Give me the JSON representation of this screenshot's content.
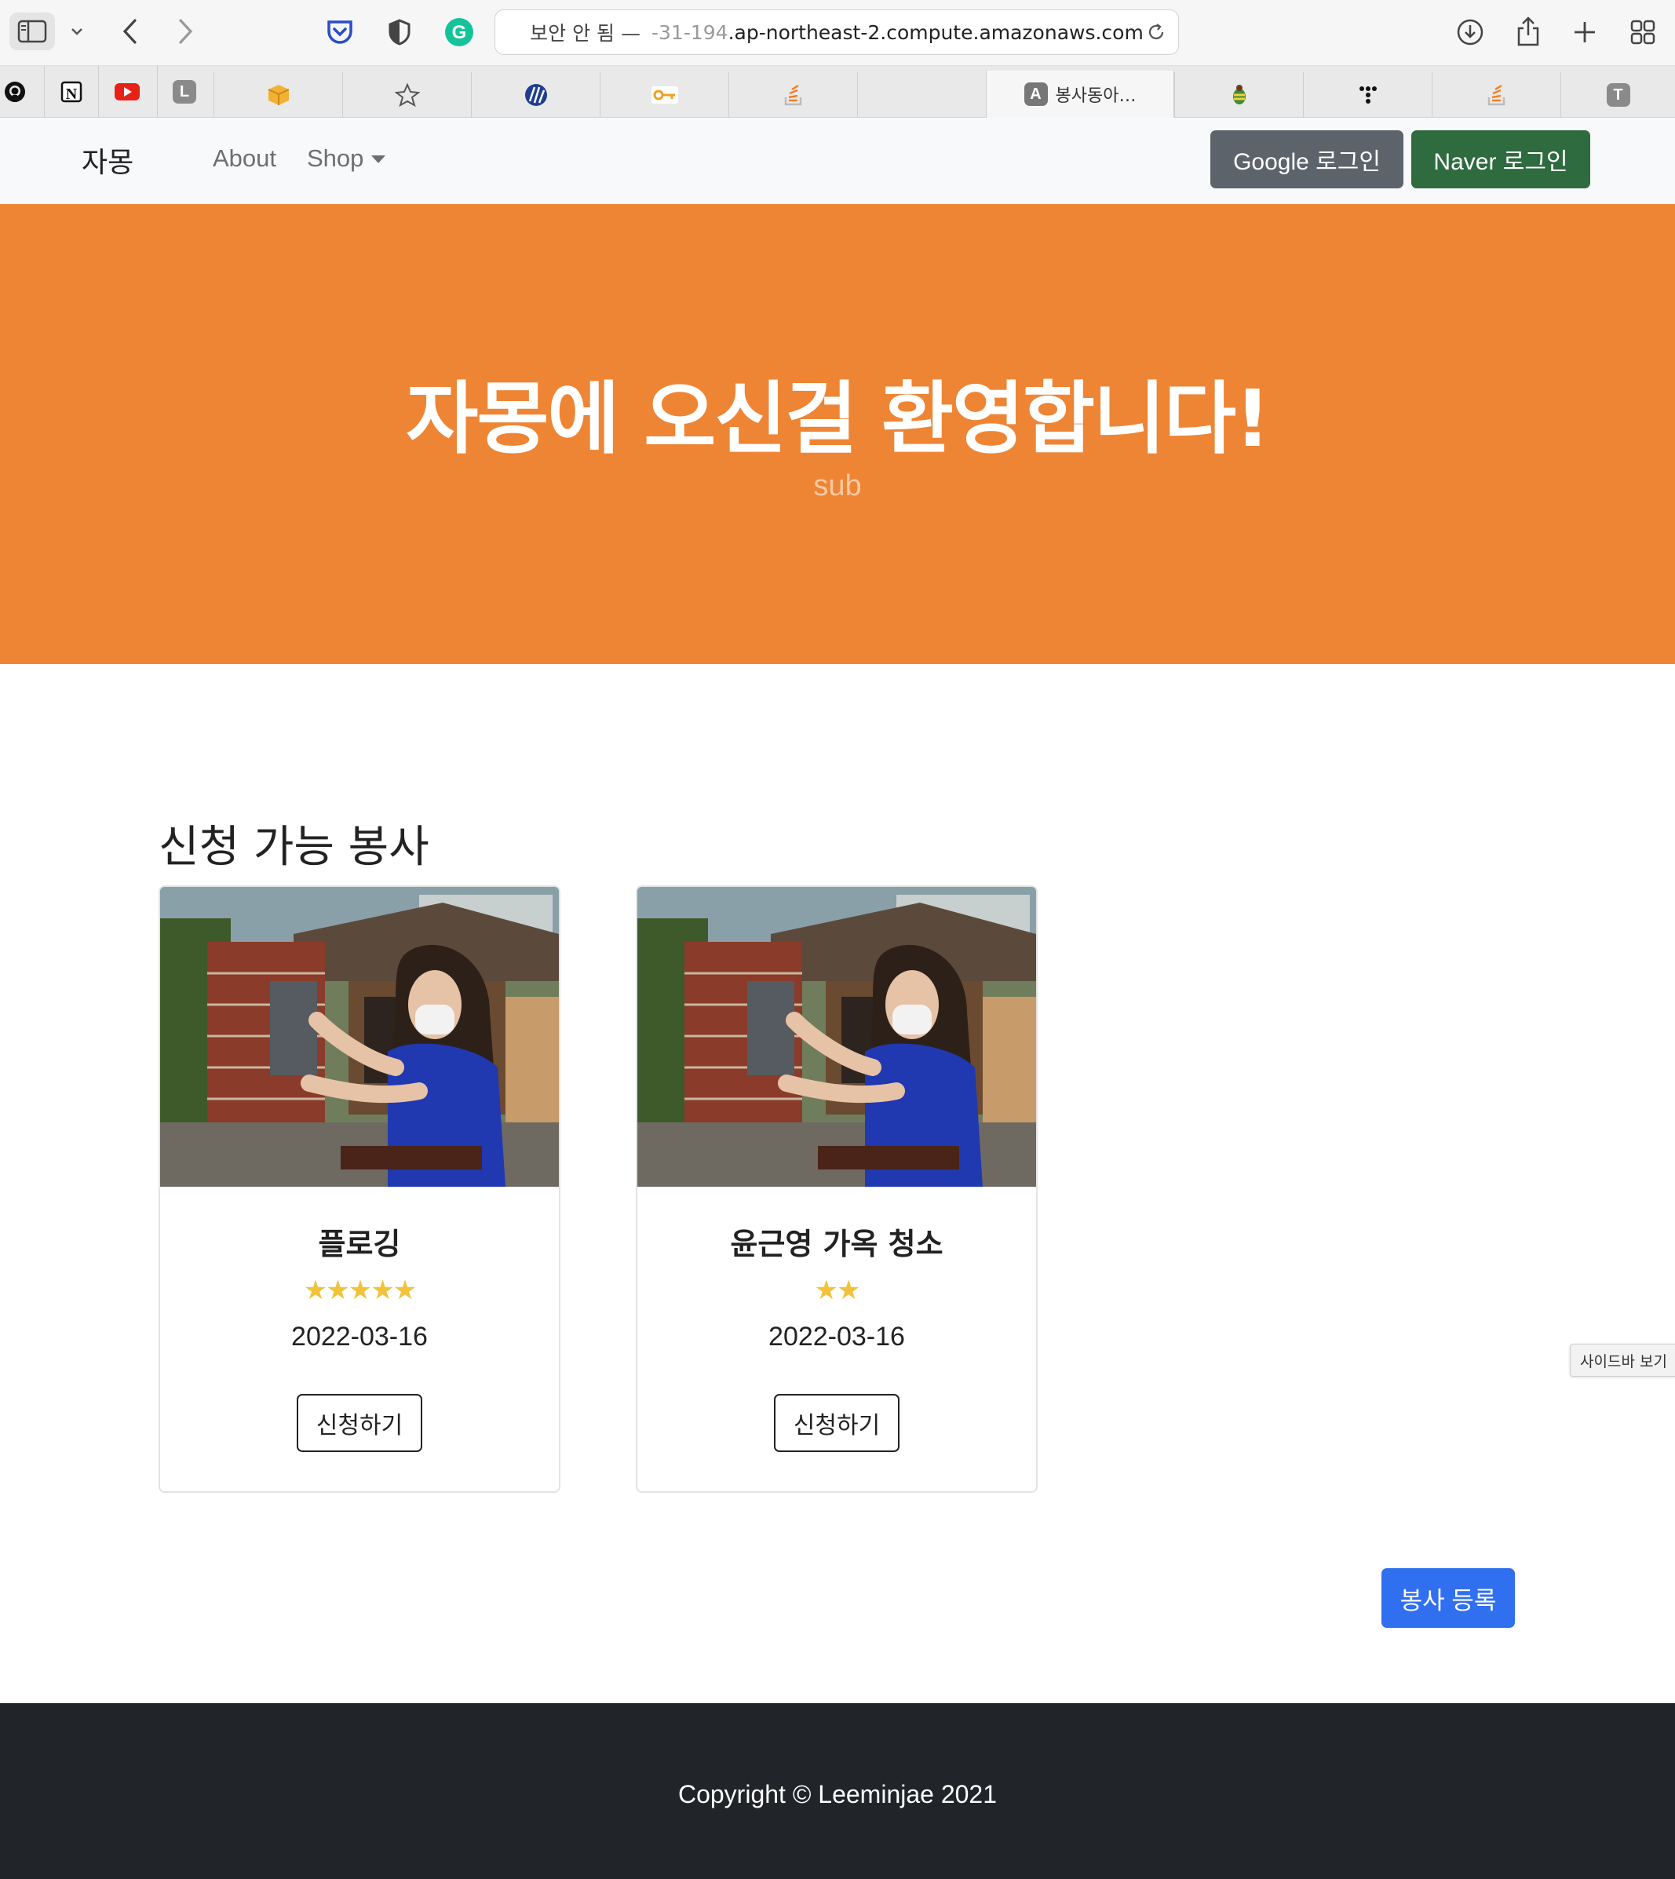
{
  "browser": {
    "address": {
      "security_label": "보안 안 됨 —",
      "host_prefix": "-31-194",
      "host_main": ".ap-northeast-2.compute.amazonaws.com"
    },
    "tabs": [
      {
        "name": "github-tab",
        "icon": "github-icon"
      },
      {
        "name": "notion-tab",
        "icon": "notion-icon"
      },
      {
        "name": "youtube-tab",
        "icon": "youtube-icon"
      },
      {
        "name": "l-tab",
        "icon": "letter-l-icon",
        "letter": "L"
      },
      {
        "name": "box-tab",
        "icon": "box-icon"
      },
      {
        "name": "star-tab",
        "icon": "star-icon"
      },
      {
        "name": "globe-tab",
        "icon": "globe-icon"
      },
      {
        "name": "key-tab",
        "icon": "key-icon"
      },
      {
        "name": "stack-tab",
        "icon": "stackoverflow-icon"
      },
      {
        "name": "blank-tab",
        "icon": ""
      },
      {
        "name": "active-tab",
        "icon": "letter-a-icon",
        "letter": "A",
        "label": "봉사동아…"
      },
      {
        "name": "bee-tab",
        "icon": "bee-icon"
      },
      {
        "name": "dots-tab",
        "icon": "dots-icon"
      },
      {
        "name": "stack-tab-2",
        "icon": "stackoverflow-icon"
      },
      {
        "name": "t-tab",
        "icon": "letter-t-icon",
        "letter": "T"
      }
    ]
  },
  "navbar": {
    "brand": "자몽",
    "about": "About",
    "shop": "Shop",
    "google_login": "Google 로그인",
    "naver_login": "Naver 로그인"
  },
  "hero": {
    "title": "자몽에 오신걸 환영합니다!",
    "subtitle": "sub",
    "color": "#ee8535"
  },
  "section": {
    "title": "신청 가능 봉사"
  },
  "cards": [
    {
      "title": "플로깅",
      "rating": 5,
      "stars": "★★★★★",
      "date": "2022-03-16",
      "button": "신청하기"
    },
    {
      "title": "윤근영 가옥 청소",
      "rating": 2,
      "stars": "★★",
      "date": "2022-03-16",
      "button": "신청하기"
    }
  ],
  "register_button": "봉사 등록",
  "sidebar_tooltip": "사이드바 보기",
  "footer": {
    "text": "Copyright © Leeminjae 2021"
  },
  "colors": {
    "primary": "#2f6ff0",
    "naver": "#2e6b3e",
    "google": "#5c636a",
    "footer": "#212529",
    "star": "#f2c23a"
  }
}
